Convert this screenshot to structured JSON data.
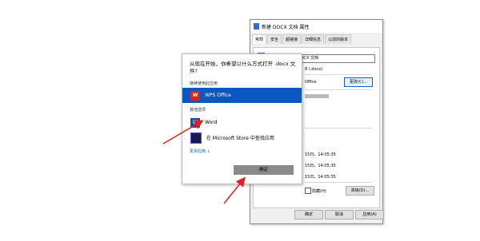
{
  "props_dialog": {
    "title": "新建 DOCX 文档 属性",
    "tabs": [
      "常规",
      "安全",
      "超链接",
      "详细信息",
      "以前的版本"
    ],
    "file_name": "新建 DOCX 文档",
    "file_type": "8 (.docx)",
    "opens_with": "Office",
    "change_button": "更改(C)...",
    "dates": [
      "15日，14:05:35",
      "15日，14:05:35",
      "15日，14:05:35"
    ],
    "hidden_label": "隐藏(H)",
    "advanced_button": "高级(D)...",
    "ok_button": "确定",
    "cancel_button": "取消",
    "apply_button": "应用(A)"
  },
  "open_with": {
    "title": "从现在开始，你希望以什么方式打开 .docx 文件?",
    "continue_section": "继续使用此应用",
    "other_section": "其他选项",
    "apps": [
      {
        "label": "WPS Office",
        "icon": "wps-icon"
      },
      {
        "label": "Word",
        "icon": "word-icon"
      },
      {
        "label": "在 Microsoft Store 中查找应用",
        "icon": "store-icon"
      }
    ],
    "more_apps": "更多应用 ↓",
    "ok_button": "确定"
  }
}
